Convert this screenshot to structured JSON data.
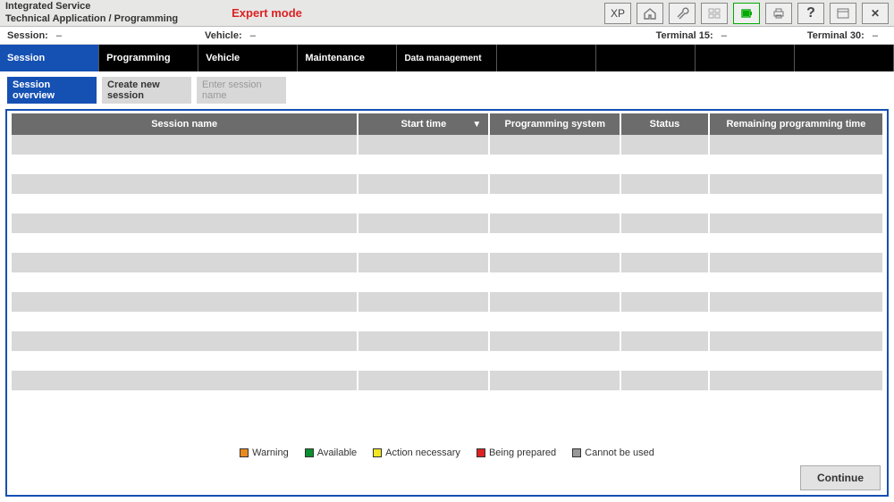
{
  "header": {
    "title_line1": "Integrated Service",
    "title_line2": "Technical Application / Programming",
    "mode": "Expert mode",
    "buttons": {
      "xp": "XP",
      "home": "home-icon",
      "wrench": "wrench-icon",
      "grid": "grid-icon",
      "battery": "battery-icon",
      "print": "print-icon",
      "help": "?",
      "window": "window-icon",
      "close": "✕"
    }
  },
  "infobar": {
    "session_label": "Session:",
    "session_value": "–",
    "vehicle_label": "Vehicle:",
    "vehicle_value": "–",
    "t15_label": "Terminal 15:",
    "t15_value": "–",
    "t30_label": "Terminal 30:",
    "t30_value": "–"
  },
  "mainnav": [
    "Session",
    "Programming",
    "Vehicle",
    "Maintenance",
    "Data management",
    "",
    "",
    "",
    ""
  ],
  "subtabs": {
    "overview": "Session overview",
    "create": "Create new session",
    "enter": "Enter session name"
  },
  "table": {
    "headers": {
      "name": "Session name",
      "start": "Start time",
      "system": "Programming system",
      "status": "Status",
      "remaining": "Remaining programming time"
    },
    "row_count": 14
  },
  "legend": {
    "warning": "Warning",
    "available": "Available",
    "action": "Action necessary",
    "prepared": "Being prepared",
    "cannot": "Cannot be used"
  },
  "footer": {
    "continue": "Continue"
  }
}
